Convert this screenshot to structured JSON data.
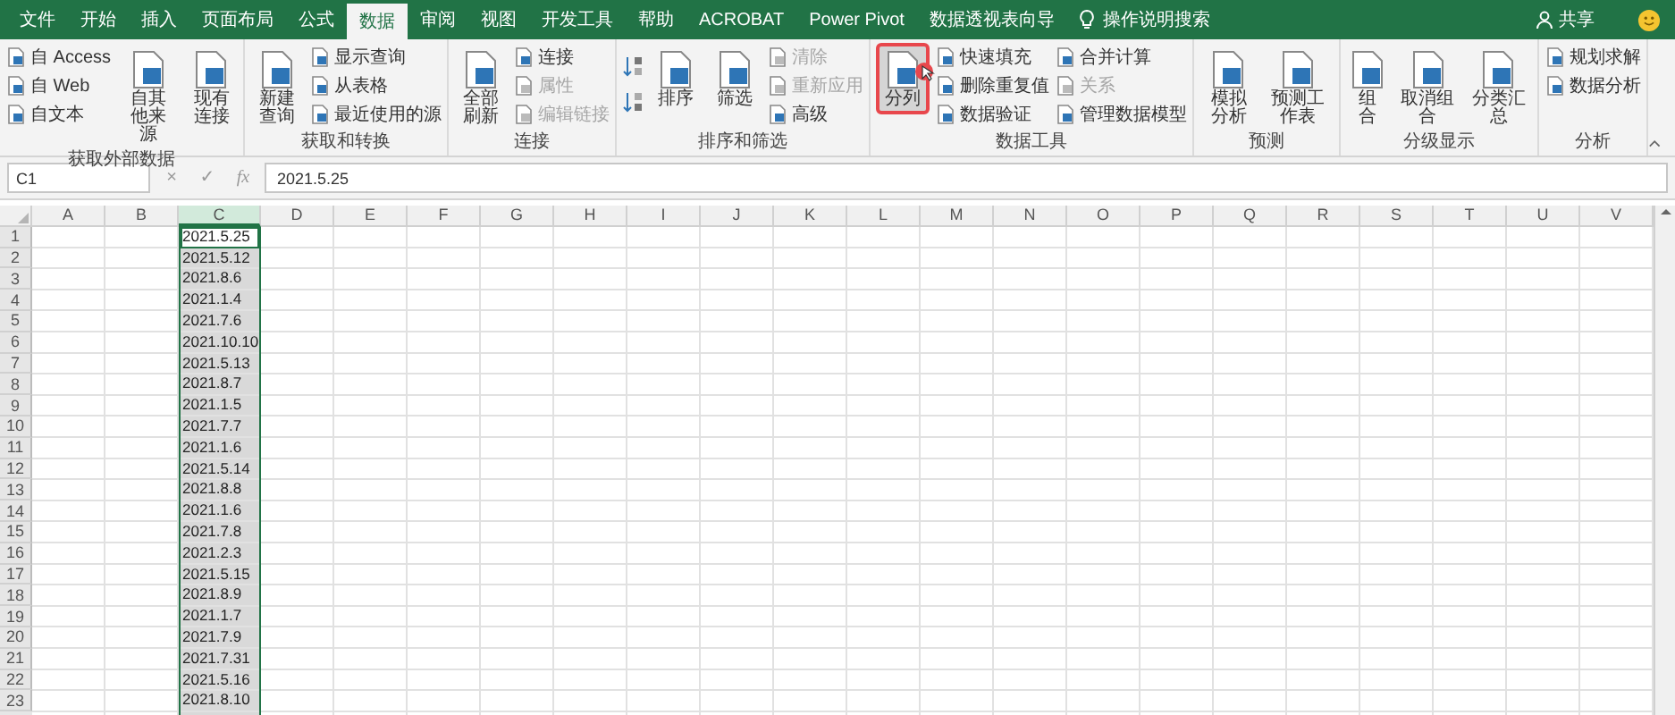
{
  "tabs": [
    {
      "label": "文件",
      "selected": false
    },
    {
      "label": "开始",
      "selected": false
    },
    {
      "label": "插入",
      "selected": false
    },
    {
      "label": "页面布局",
      "selected": false
    },
    {
      "label": "公式",
      "selected": false
    },
    {
      "label": "数据",
      "selected": true
    },
    {
      "label": "审阅",
      "selected": false
    },
    {
      "label": "视图",
      "selected": false
    },
    {
      "label": "开发工具",
      "selected": false
    },
    {
      "label": "帮助",
      "selected": false
    },
    {
      "label": "ACROBAT",
      "selected": false
    },
    {
      "label": "Power Pivot",
      "selected": false
    },
    {
      "label": "数据透视表向导",
      "selected": false
    }
  ],
  "search": {
    "placeholder": "操作说明搜索"
  },
  "share": "共享",
  "ribbon": {
    "groups": [
      {
        "label": "获取外部数据",
        "items": [
          {
            "kind": "stack",
            "entries": [
              {
                "label": "自 Access",
                "disabled": false
              },
              {
                "label": "自 Web",
                "disabled": false
              },
              {
                "label": "自文本",
                "disabled": false
              }
            ]
          },
          {
            "kind": "large",
            "label": "自其他来源",
            "disabled": false,
            "selected": false
          },
          {
            "kind": "large",
            "label": "现有连接",
            "disabled": false,
            "selected": false
          }
        ]
      },
      {
        "label": "获取和转换",
        "items": [
          {
            "kind": "large",
            "label": "新建查询",
            "disabled": false,
            "selected": false
          },
          {
            "kind": "stack",
            "entries": [
              {
                "label": "显示查询",
                "disabled": false
              },
              {
                "label": "从表格",
                "disabled": false
              },
              {
                "label": "最近使用的源",
                "disabled": false
              }
            ]
          }
        ]
      },
      {
        "label": "连接",
        "items": [
          {
            "kind": "large",
            "label": "全部刷新",
            "disabled": false,
            "selected": false
          },
          {
            "kind": "stack",
            "entries": [
              {
                "label": "连接",
                "disabled": false
              },
              {
                "label": "属性",
                "disabled": true
              },
              {
                "label": "编辑链接",
                "disabled": true
              }
            ]
          }
        ]
      },
      {
        "label": "排序和筛选",
        "items": [
          {
            "kind": "sort"
          },
          {
            "kind": "large",
            "label": "排序",
            "disabled": false,
            "selected": false
          },
          {
            "kind": "large",
            "label": "筛选",
            "disabled": false,
            "selected": false
          },
          {
            "kind": "stack",
            "entries": [
              {
                "label": "清除",
                "disabled": true
              },
              {
                "label": "重新应用",
                "disabled": true
              },
              {
                "label": "高级",
                "disabled": false
              }
            ]
          }
        ]
      },
      {
        "label": "数据工具",
        "items": [
          {
            "kind": "large",
            "label": "分列",
            "disabled": false,
            "selected": true
          },
          {
            "kind": "stack",
            "entries": [
              {
                "label": "快速填充",
                "disabled": false
              },
              {
                "label": "删除重复值",
                "disabled": false
              },
              {
                "label": "数据验证",
                "disabled": false
              }
            ]
          },
          {
            "kind": "stack",
            "entries": [
              {
                "label": "合并计算",
                "disabled": false
              },
              {
                "label": "关系",
                "disabled": true
              },
              {
                "label": "管理数据模型",
                "disabled": false
              }
            ]
          }
        ]
      },
      {
        "label": "预测",
        "items": [
          {
            "kind": "large",
            "label": "模拟分析",
            "disabled": false,
            "selected": false
          },
          {
            "kind": "large",
            "label": "预测工作表",
            "disabled": false,
            "selected": false
          }
        ]
      },
      {
        "label": "分级显示",
        "items": [
          {
            "kind": "large",
            "label": "组合",
            "disabled": false,
            "selected": false
          },
          {
            "kind": "large",
            "label": "取消组合",
            "disabled": false,
            "selected": false
          },
          {
            "kind": "large",
            "label": "分类汇总",
            "disabled": false,
            "selected": false
          }
        ]
      },
      {
        "label": "分析",
        "items": [
          {
            "kind": "stack",
            "entries": [
              {
                "label": "规划求解",
                "disabled": false
              },
              {
                "label": "数据分析",
                "disabled": false
              }
            ]
          }
        ]
      }
    ]
  },
  "formula_bar": {
    "name_box": "C1",
    "cancel": "×",
    "enter": "✓",
    "fx": "fx",
    "value": "2021.5.25"
  },
  "sheet": {
    "columns": [
      {
        "label": "A",
        "selected": false
      },
      {
        "label": "B",
        "selected": false
      },
      {
        "label": "C",
        "selected": true
      },
      {
        "label": "D",
        "selected": false
      },
      {
        "label": "E",
        "selected": false
      },
      {
        "label": "F",
        "selected": false
      },
      {
        "label": "G",
        "selected": false
      },
      {
        "label": "H",
        "selected": false
      },
      {
        "label": "I",
        "selected": false
      },
      {
        "label": "J",
        "selected": false
      },
      {
        "label": "K",
        "selected": false
      },
      {
        "label": "L",
        "selected": false
      },
      {
        "label": "M",
        "selected": false
      },
      {
        "label": "N",
        "selected": false
      },
      {
        "label": "O",
        "selected": false
      },
      {
        "label": "P",
        "selected": false
      },
      {
        "label": "Q",
        "selected": false
      },
      {
        "label": "R",
        "selected": false
      },
      {
        "label": "S",
        "selected": false
      },
      {
        "label": "T",
        "selected": false
      },
      {
        "label": "U",
        "selected": false
      },
      {
        "label": "V",
        "selected": false
      }
    ],
    "rows": [
      {
        "label": "1",
        "value": "2021.5.25",
        "active": true
      },
      {
        "label": "2",
        "value": "2021.5.12",
        "active": false
      },
      {
        "label": "3",
        "value": "2021.8.6",
        "active": false
      },
      {
        "label": "4",
        "value": "2021.1.4",
        "active": false
      },
      {
        "label": "5",
        "value": "2021.7.6",
        "active": false
      },
      {
        "label": "6",
        "value": "2021.10.10",
        "active": false
      },
      {
        "label": "7",
        "value": "2021.5.13",
        "active": false
      },
      {
        "label": "8",
        "value": "2021.8.7",
        "active": false
      },
      {
        "label": "9",
        "value": "2021.1.5",
        "active": false
      },
      {
        "label": "10",
        "value": "2021.7.7",
        "active": false
      },
      {
        "label": "11",
        "value": "2021.1.6",
        "active": false
      },
      {
        "label": "12",
        "value": "2021.5.14",
        "active": false
      },
      {
        "label": "13",
        "value": "2021.8.8",
        "active": false
      },
      {
        "label": "14",
        "value": "2021.1.6",
        "active": false
      },
      {
        "label": "15",
        "value": "2021.7.8",
        "active": false
      },
      {
        "label": "16",
        "value": "2021.2.3",
        "active": false
      },
      {
        "label": "17",
        "value": "2021.5.15",
        "active": false
      },
      {
        "label": "18",
        "value": "2021.8.9",
        "active": false
      },
      {
        "label": "19",
        "value": "2021.1.7",
        "active": false
      },
      {
        "label": "20",
        "value": "2021.7.9",
        "active": false
      },
      {
        "label": "21",
        "value": "2021.7.31",
        "active": false
      },
      {
        "label": "22",
        "value": "2021.5.16",
        "active": false
      },
      {
        "label": "23",
        "value": "2021.8.10",
        "active": false
      }
    ]
  }
}
